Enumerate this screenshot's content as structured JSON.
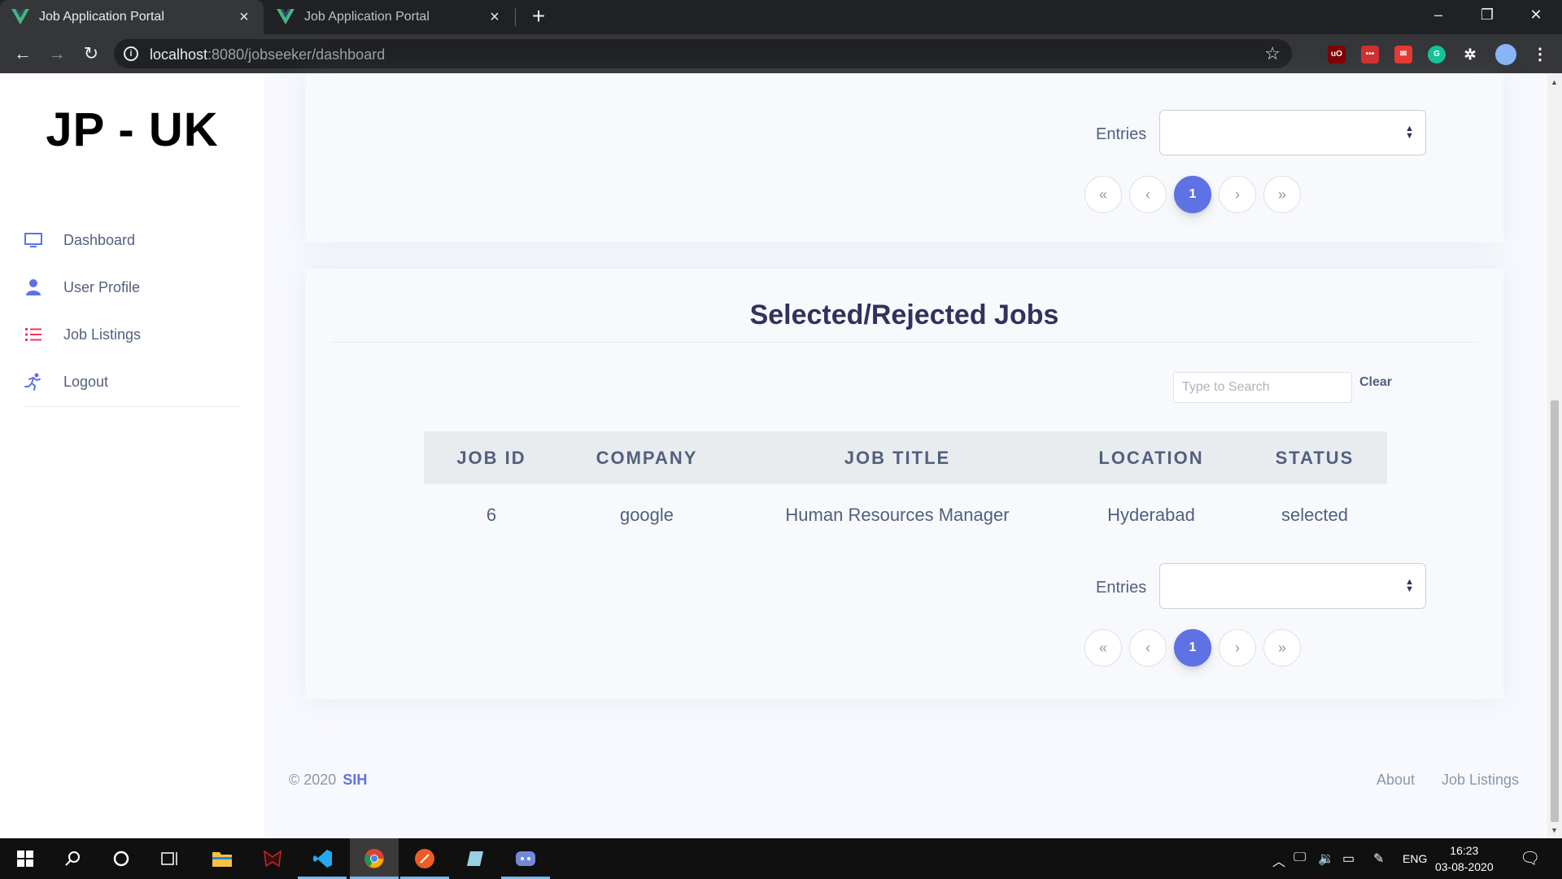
{
  "browser": {
    "tabs": [
      {
        "title": "Job Application Portal",
        "active": true
      },
      {
        "title": "Job Application Portal",
        "active": false
      }
    ],
    "url_host": "localhost",
    "url_path": ":8080/jobseeker/dashboard"
  },
  "sidebar": {
    "brand": "JP - UK",
    "items": [
      {
        "label": "Dashboard",
        "icon": "monitor-icon"
      },
      {
        "label": "User Profile",
        "icon": "user-icon"
      },
      {
        "label": "Job Listings",
        "icon": "list-icon"
      },
      {
        "label": "Logout",
        "icon": "running-person-icon"
      }
    ]
  },
  "top_card": {
    "entries_label": "Entries",
    "entries_value": "",
    "pagination": [
      "«",
      "‹",
      "1",
      "›",
      "»"
    ],
    "current_page": "1"
  },
  "jobs_card": {
    "title": "Selected/Rejected Jobs",
    "search_placeholder": "Type to Search",
    "clear_label": "Clear",
    "columns": [
      "JOB ID",
      "COMPANY",
      "JOB TITLE",
      "LOCATION",
      "STATUS"
    ],
    "rows": [
      [
        "6",
        "google",
        "Human Resources Manager",
        "Hyderabad",
        "selected"
      ]
    ],
    "entries_label": "Entries",
    "entries_value": "",
    "pagination": [
      "«",
      "‹",
      "1",
      "›",
      "»"
    ],
    "current_page": "1"
  },
  "footer": {
    "copyright": "© 2020",
    "brand": "SIH",
    "links": [
      "About",
      "Job Listings"
    ]
  },
  "taskbar": {
    "language": "ENG",
    "time": "16:23",
    "date": "03-08-2020"
  },
  "colors": {
    "accent": "#5e72e4",
    "heading": "#32325d",
    "text": "#525f7f"
  }
}
